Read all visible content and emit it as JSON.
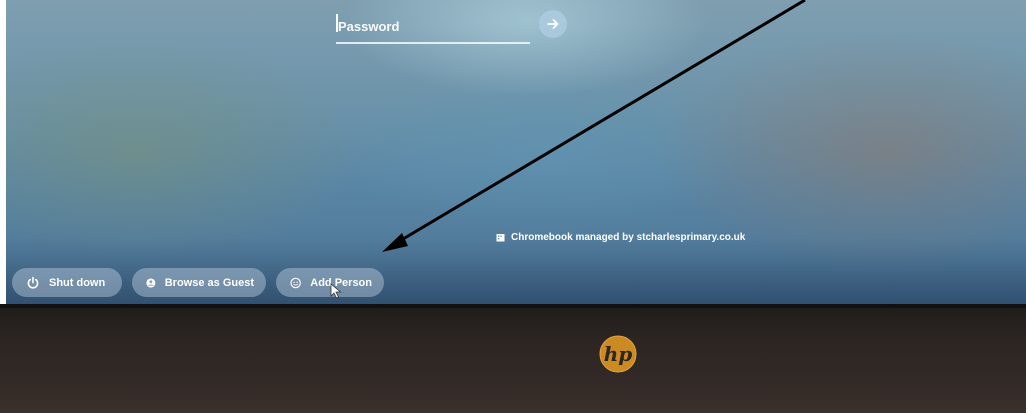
{
  "login": {
    "password_placeholder": "Password",
    "submit_icon": "arrow-right-icon"
  },
  "footer_notice": {
    "icon": "building-icon",
    "text": "Chromebook managed by stcharlesprimary.co.uk"
  },
  "shelf": {
    "buttons": [
      {
        "label": "Shut down",
        "icon": "power-icon"
      },
      {
        "label": "Browse as Guest",
        "icon": "guest-icon"
      },
      {
        "label": "Add Person",
        "icon": "add-person-icon"
      }
    ]
  },
  "hardware": {
    "logo_text": "hp"
  },
  "colors": {
    "wallpaper": "#6c93aa",
    "bezel": "#2c2522",
    "annotation_arrow": "#000000"
  }
}
